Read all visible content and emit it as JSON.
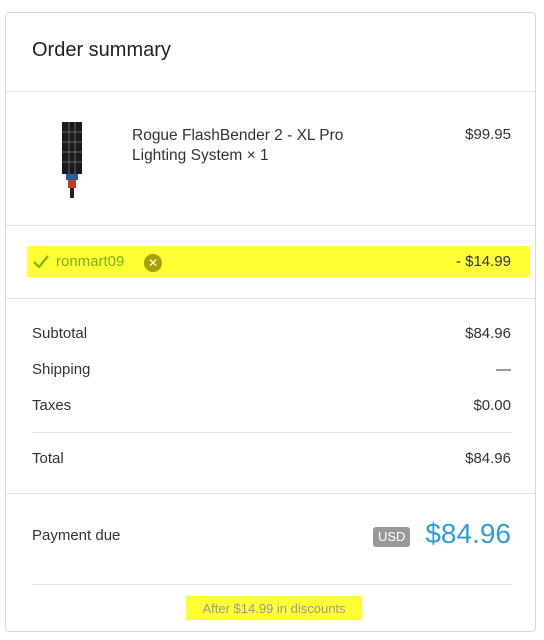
{
  "header": {
    "title": "Order summary"
  },
  "product": {
    "image_icon": "lighting-softbox-product-image",
    "name": "Rogue FlashBender 2 - XL Pro Lighting System × 1",
    "price": "$99.95"
  },
  "discount": {
    "code": "ronmart09",
    "remove_symbol": "✕",
    "amount": "- $14.99",
    "code_color": "#7ab317",
    "highlight_color": "#ffff33"
  },
  "totals": {
    "subtotal_label": "Subtotal",
    "subtotal_value": "$84.96",
    "shipping_label": "Shipping",
    "shipping_value": "—",
    "taxes_label": "Taxes",
    "taxes_value": "$0.00",
    "total_label": "Total",
    "total_value": "$84.96"
  },
  "payment": {
    "label": "Payment due",
    "currency": "USD",
    "amount": "$84.96",
    "amount_color": "#2f9ed6",
    "savings_note": "After $14.99 in discounts"
  }
}
